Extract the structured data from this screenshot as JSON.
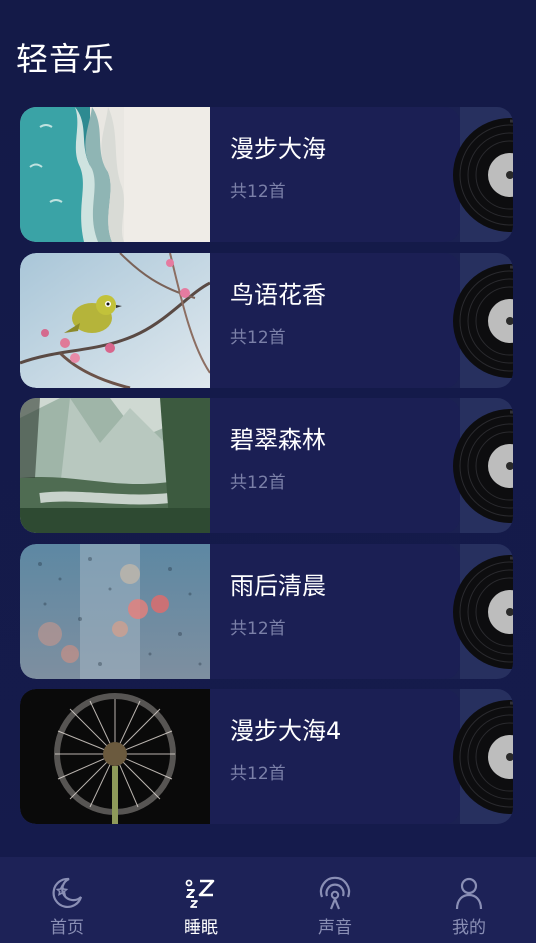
{
  "header": {
    "title": "轻音乐"
  },
  "playlists": [
    {
      "title": "漫步大海",
      "count": "共12首",
      "image": "ocean-beach-aerial"
    },
    {
      "title": "鸟语花香",
      "count": "共12首",
      "image": "bird-on-blossom-branch"
    },
    {
      "title": "碧翠森林",
      "count": "共12首",
      "image": "mountain-forest-valley"
    },
    {
      "title": "雨后清晨",
      "count": "共12首",
      "image": "raindrops-on-glass-bokeh"
    },
    {
      "title": "漫步大海4",
      "count": "共12首",
      "image": "dandelion-seed-head"
    }
  ],
  "tabbar": {
    "tabs": [
      {
        "label": "首页",
        "icon": "moon-star-icon",
        "active": false
      },
      {
        "label": "睡眠",
        "icon": "sleep-zzz-icon",
        "active": true
      },
      {
        "label": "声音",
        "icon": "sound-waves-icon",
        "active": false
      },
      {
        "label": "我的",
        "icon": "person-icon",
        "active": false
      }
    ]
  },
  "colors": {
    "background": "#141a48",
    "card": "#1b1f54",
    "card_edge": "#27305f",
    "muted_text": "#7b80a8",
    "tabbar": "#1d2257"
  }
}
